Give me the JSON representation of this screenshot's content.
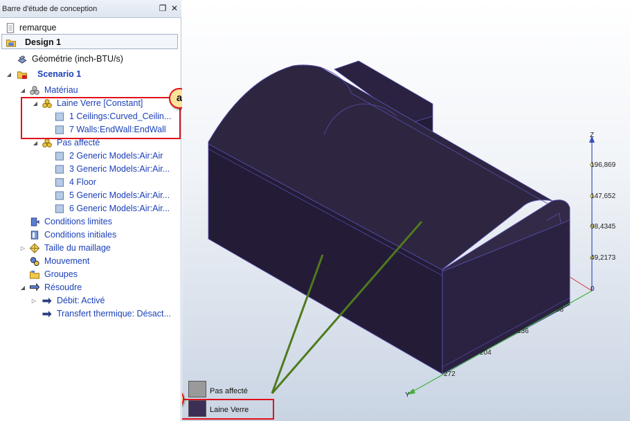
{
  "panel": {
    "title": "Barre d'étude de conception",
    "pin_icon": "pin-icon",
    "close_icon": "close-icon"
  },
  "tree": {
    "remarque": "remarque",
    "design": "Design 1",
    "geometrie": "Géométrie (inch-BTU/s)",
    "scenario": "Scenario 1",
    "materiau": "Matériau",
    "laine_verre": "Laine Verre [Constant]",
    "laine_items": [
      "1 Ceilings:Curved_Ceilin...",
      "7 Walls:EndWall:EndWall"
    ],
    "pas_affecte": "Pas affecté",
    "pas_items": [
      "2 Generic Models:Air:Air",
      "3 Generic Models:Air:Air...",
      "4 Floor",
      "5 Generic Models:Air:Air...",
      "6 Generic Models:Air:Air..."
    ],
    "conditions_limites": "Conditions limites",
    "conditions_initiales": "Conditions initiales",
    "taille_maillage": "Taille du maillage",
    "mouvement": "Mouvement",
    "groupes": "Groupes",
    "resoudre": "Résoudre",
    "debit": "Débit: Activé",
    "transfert": "Transfert thermique: Désact..."
  },
  "callouts": {
    "a": "a",
    "b": "b"
  },
  "legend": [
    {
      "label": "Pas affecté",
      "color": "#9a9a9a"
    },
    {
      "label": "Laine Verre",
      "color": "#3b2f55"
    }
  ],
  "axes": {
    "z_label": "Z",
    "y_label": "Y",
    "z_ticks": [
      "196,869",
      "147,652",
      "98,4345",
      "49,2173",
      "0"
    ],
    "y_ticks": [
      "68",
      "136",
      "204",
      "272"
    ]
  },
  "colors": {
    "solid": "#2e2540",
    "solid_edge": "#5a4fb0",
    "annotation": "#e0101a",
    "leader": "#4f7a1e"
  }
}
